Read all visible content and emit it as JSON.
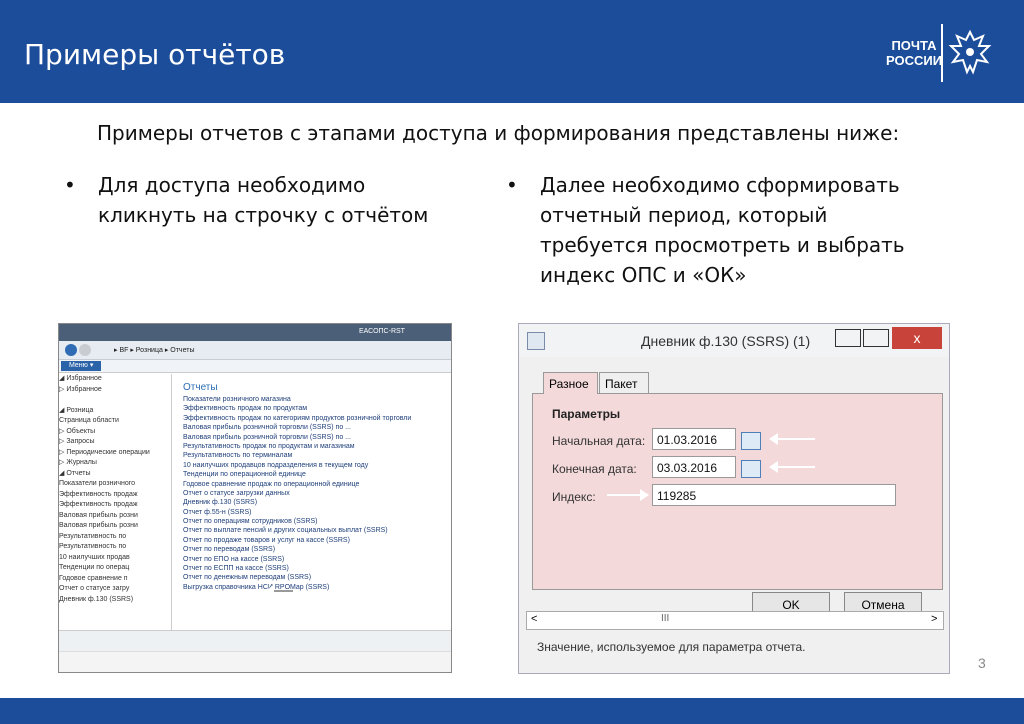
{
  "slide": {
    "title": "Примеры отчётов",
    "logo_line1": "ПОЧТА",
    "logo_line2": "РОССИИ",
    "intro": "Примеры отчетов с этапами доступа и формирования представлены ниже:",
    "bullet1_line1": "Для доступа необходимо",
    "bullet1_line2": "кликнуть на строчку с отчётом",
    "bullet2_line1": "Далее необходимо сформировать",
    "bullet2_line2": "отчетный период, который",
    "bullet2_line3": "требуется просмотреть и выбрать",
    "bullet2_line4": "индекс ОПС и «ОК»",
    "bullet_char": "•",
    "page_number": "3"
  },
  "app_window": {
    "title": "ЕАСОПС-RST",
    "breadcrumb": "▸ BF ▸ Розница ▸ Отчеты",
    "menu_label": "Меню ▾",
    "tree": [
      "◢ Избранное",
      "  ▷ Избранное",
      "",
      "◢ Розница",
      "    Страница области",
      "  ▷ Объекты",
      "  ▷ Запросы",
      "  ▷ Периодические операции",
      "  ▷ Журналы",
      "  ◢ Отчеты",
      "      Показатели розничного",
      "      Эффективность продаж",
      "      Эффективность продаж",
      "      Валовая прибыль розни",
      "      Валовая прибыль розни",
      "      Результативность по",
      "      Результативность по",
      "      10 наилучших продав",
      "      Тенденции по операц",
      "      Годовое сравнение п",
      "      Отчет о статусе загру",
      "      Дневник ф.130 (SSRS)"
    ],
    "section_title": "Отчеты",
    "reports": [
      "Показатели розничного магазина",
      "Эффективность продаж по продуктам",
      "Эффективность продаж по категориям продуктов розничной торговли",
      "Валовая прибыль розничной торговли (SSRS) по ...",
      "Валовая прибыль розничной торговли (SSRS) по ...",
      "Результативность продаж по продуктам и магазинам",
      "Результативность по терминалам",
      "10 наилучших продавцов подразделения в текущем году",
      "Тенденции по операционной единице",
      "Годовое сравнение продаж по операционной единице",
      "Отчет о статусе загрузки данных",
      "Дневник ф.130 (SSRS)",
      "Отчет ф.55-н (SSRS)",
      "Отчет по операциям сотрудников (SSRS)",
      "Отчет по выплате пенсий и других социальных выплат (SSRS)",
      "Отчет по продаже товаров и услуг на кассе (SSRS)",
      "Отчет по переводам (SSRS)",
      "Отчет по ЕПО на кассе (SSRS)",
      "Отчет по ЕСПП на кассе (SSRS)",
      "Отчет по денежным переводам (SSRS)",
      "Выгрузка справочника НСИ RPOMap (SSRS)"
    ]
  },
  "dialog": {
    "title": "Дневник ф.130 (SSRS) (1)",
    "close_label": "x",
    "tab1": "Разное",
    "tab2": "Пакет",
    "group": "Параметры",
    "start_label": "Начальная дата:",
    "start_value": "01.03.2016",
    "end_label": "Конечная дата:",
    "end_value": "03.03.2016",
    "index_label": "Индекс:",
    "index_value": "119285",
    "dropdown_glyph": "⌄",
    "ok_label": "OK",
    "cancel_label": "Отмена",
    "scroll_mid": "III",
    "scroll_left": "<",
    "scroll_right": ">",
    "status": "Значение, используемое для параметра отчета."
  },
  "colors": {
    "header_bg": "#1c4d9a",
    "dialog_panel": "#f3d9da",
    "close_button": "#c8443a"
  }
}
